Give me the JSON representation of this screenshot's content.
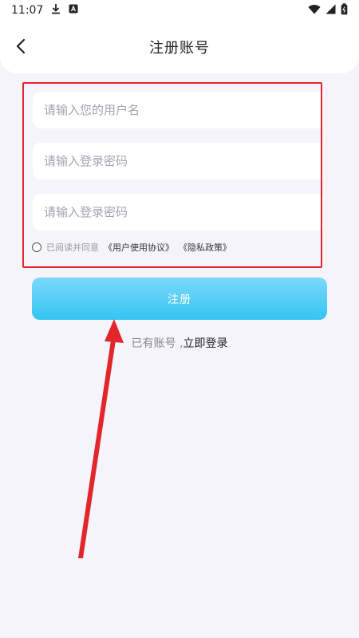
{
  "status_bar": {
    "time": "11:07"
  },
  "header": {
    "title": "注册账号"
  },
  "form": {
    "username_placeholder": "请输入您的用户名",
    "password_placeholder": "请输入登录密码",
    "confirm_placeholder": "请输入登录密码",
    "agree_text": "已阅读并同意",
    "user_agreement": "《用户使用协议》",
    "privacy_policy": "《隐私政策》"
  },
  "actions": {
    "register_label": "注册",
    "have_account": "已有账号 ,",
    "login_link": "立即登录"
  },
  "annotation": {
    "highlight_color": "#e2262b"
  },
  "colors": {
    "accent": "#34c4f3",
    "background": "#f6f4fb"
  }
}
